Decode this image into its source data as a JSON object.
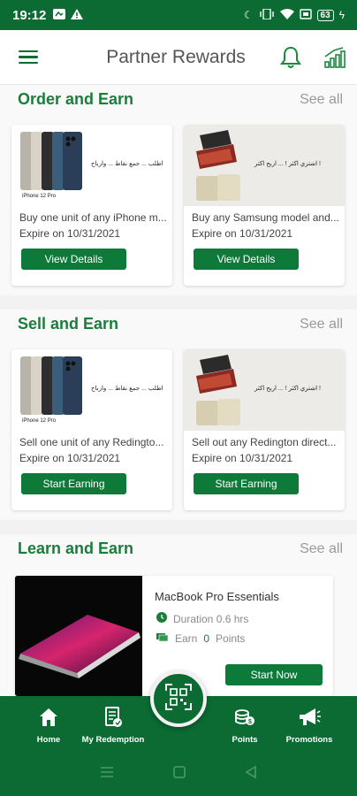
{
  "status": {
    "time": "19:12",
    "battery": "63"
  },
  "header": {
    "title": "Partner Rewards"
  },
  "sections": [
    {
      "title": "Order and Earn",
      "see_all": "See all",
      "cards": [
        {
          "title": "Buy one unit of any iPhone m...",
          "expire": "Expire on 10/31/2021",
          "button": "View Details",
          "promo": "اطلب ... جمع نقاط ... وارباح",
          "caption": "iPhone 12 Pro"
        },
        {
          "title": "Buy any Samsung model and...",
          "expire": "Expire on 10/31/2021",
          "button": "View Details",
          "promo": "اشتري اكثر ! ... اربح اكثر !"
        }
      ]
    },
    {
      "title": "Sell and Earn",
      "see_all": "See all",
      "cards": [
        {
          "title": "Sell one unit of any Redingto...",
          "expire": "Expire on 10/31/2021",
          "button": "Start Earning",
          "promo": "اطلب ... جمع نقاط ... وارباح",
          "caption": "iPhone 12 Pro"
        },
        {
          "title": "Sell out any Redington direct...",
          "expire": "Expire on 10/31/2021",
          "button": "Start Earning",
          "promo": "اشتري اكثر ! ... اربح اكثر !"
        }
      ]
    },
    {
      "title": "Learn and Earn",
      "see_all": "See all",
      "course": {
        "title": "MacBook Pro Essentials",
        "duration": "Duration 0.6 hrs",
        "earn_prefix": "Earn",
        "earn_points": "0",
        "earn_suffix": "Points",
        "button": "Start Now"
      }
    }
  ],
  "bottom_nav": [
    {
      "label": "Home",
      "icon": "home-icon"
    },
    {
      "label": "My Redemption",
      "icon": "receipt-icon"
    },
    {
      "label": "Points",
      "icon": "coins-icon"
    },
    {
      "label": "Promotions",
      "icon": "megaphone-icon"
    }
  ],
  "fab": {
    "icon": "qr-scan-icon"
  },
  "colors": {
    "primary": "#0b6b33",
    "accent_text": "#1b7d3b",
    "button": "#0d7a3a"
  }
}
